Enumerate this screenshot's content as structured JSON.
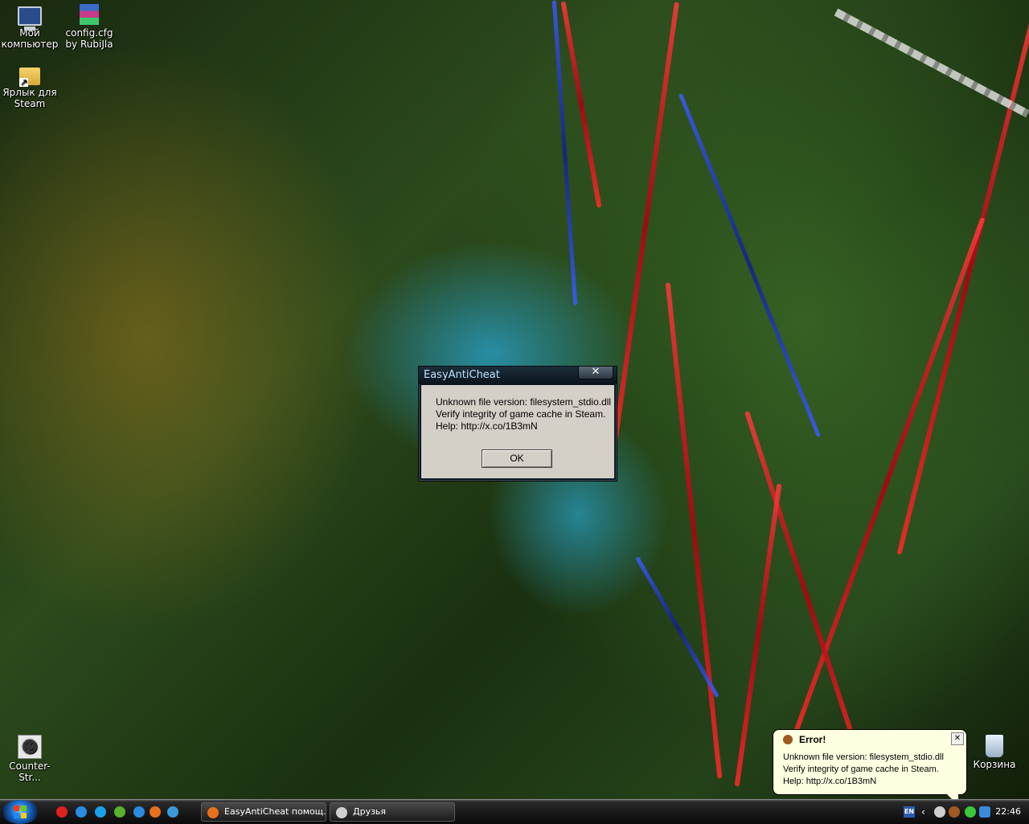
{
  "desktop": {
    "icons": [
      {
        "label": "Мой компьютер"
      },
      {
        "label": "config.cfg by RubiJla"
      },
      {
        "label": "Ярлык для Steam"
      },
      {
        "label": "Counter-Str..."
      },
      {
        "label": "Корзина"
      }
    ]
  },
  "dialog": {
    "title": "EasyAntiCheat",
    "close_label": "✕",
    "lines": [
      "Unknown file version: filesystem_stdio.dll",
      "Verify integrity of game cache in Steam.",
      "Help: http://x.co/1B3mN"
    ],
    "ok_label": "OK"
  },
  "balloon": {
    "title": "Error!",
    "close_label": "✕",
    "lines": [
      "Unknown file version: filesystem_stdio.dll",
      "Verify integrity of game cache in Steam.",
      "Help: http://x.co/1B3mN"
    ]
  },
  "taskbar": {
    "quick_launch": [
      "yandex-icon",
      "safari-icon",
      "skype-icon",
      "utorrent-icon",
      "firefox-icon",
      "refresh-icon"
    ],
    "tasks": [
      {
        "label": "EasyAntiCheat помощ..."
      },
      {
        "label": "Друзья"
      }
    ],
    "language": "EN",
    "clock": "22:46"
  }
}
